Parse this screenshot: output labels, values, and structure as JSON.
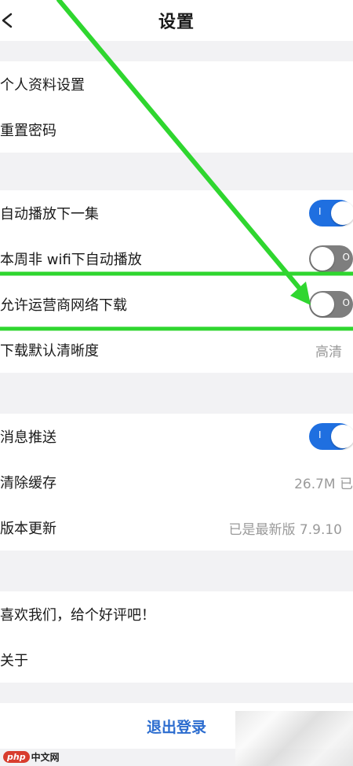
{
  "header": {
    "title": "设置"
  },
  "groups": {
    "profile": [
      {
        "label": "个人资料设置"
      },
      {
        "label": "重置密码"
      }
    ],
    "playback": [
      {
        "label": "自动播放下一集",
        "toggle": "on",
        "toggle_mark": "I"
      },
      {
        "label": "本周非 wifi下自动播放",
        "toggle": "off",
        "toggle_mark": "O"
      },
      {
        "label": "允许运营商网络下载",
        "toggle": "off",
        "toggle_mark": "O"
      },
      {
        "label": "下载默认清晰度",
        "value": "高清"
      }
    ],
    "system": [
      {
        "label": "消息推送",
        "toggle": "on",
        "toggle_mark": "I"
      },
      {
        "label": "清除缓存",
        "value": "26.7M 已"
      },
      {
        "label": "版本更新",
        "value": "已是最新版 7.9.10"
      }
    ],
    "about": [
      {
        "label": "喜欢我们，给个好评吧！"
      },
      {
        "label": "关于"
      }
    ]
  },
  "logout": {
    "label": "退出登录"
  },
  "watermark": {
    "badge": "php",
    "text": "中文网"
  },
  "colors": {
    "accent_toggle_on": "#1f6fe0",
    "toggle_off": "#7e7e7e",
    "annotation_green": "#2fd62f",
    "logout_text": "#2b6ccf"
  },
  "icons": {
    "back": "chevron-left-icon"
  }
}
